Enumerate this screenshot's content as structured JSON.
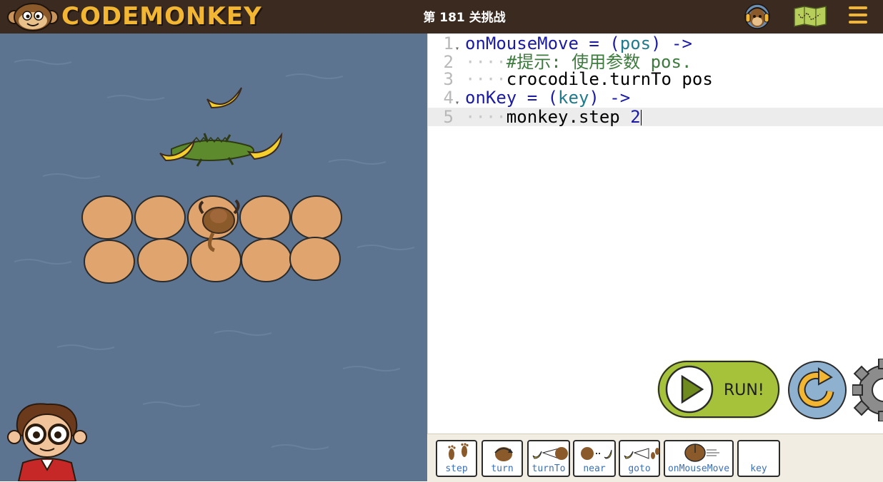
{
  "header": {
    "logo_text": "CODEMONKEY",
    "level_title": "第 181 关挑战",
    "avatar_icon": "monkey-headphones-icon",
    "map_icon": "map-icon",
    "menu_icon": "hamburger-menu-icon"
  },
  "colors": {
    "topbar": "#3b2a1f",
    "accent": "#f2b632",
    "water": "#5d7490",
    "run_green": "#a6c23a"
  },
  "code": {
    "lines": [
      {
        "num": "1",
        "fold": "▾"
      },
      {
        "num": "2",
        "fold": ""
      },
      {
        "num": "3",
        "fold": ""
      },
      {
        "num": "4",
        "fold": "▾"
      },
      {
        "num": "5",
        "fold": ""
      }
    ],
    "l1": {
      "name": "onMouseMove",
      "eq": " = (",
      "param": "pos",
      "close": ") ->"
    },
    "l2": {
      "dots": "····",
      "comment": "#提示: 使用参数 pos."
    },
    "l3": {
      "dots": "····",
      "text": "crocodile.turnTo pos"
    },
    "l4": {
      "name": "onKey",
      "eq": " = (",
      "param": "key",
      "close": ") ->"
    },
    "l5": {
      "dots": "····",
      "text": "monkey.step ",
      "num": "2"
    }
  },
  "buttons": {
    "run": "RUN!",
    "reset_icon": "reset-arrow-icon",
    "settings_icon": "gear-icon"
  },
  "toolbox": [
    {
      "label": "step",
      "icon": "footprints-icon"
    },
    {
      "label": "turn",
      "icon": "monkey-turn-icon"
    },
    {
      "label": "turnTo",
      "icon": "turnto-icon"
    },
    {
      "label": "near",
      "icon": "near-icon"
    },
    {
      "label": "goto",
      "icon": "goto-icon"
    },
    {
      "label": "onMouseMove",
      "icon": "mouse-icon"
    },
    {
      "label": "key",
      "icon": "key-icon"
    }
  ]
}
